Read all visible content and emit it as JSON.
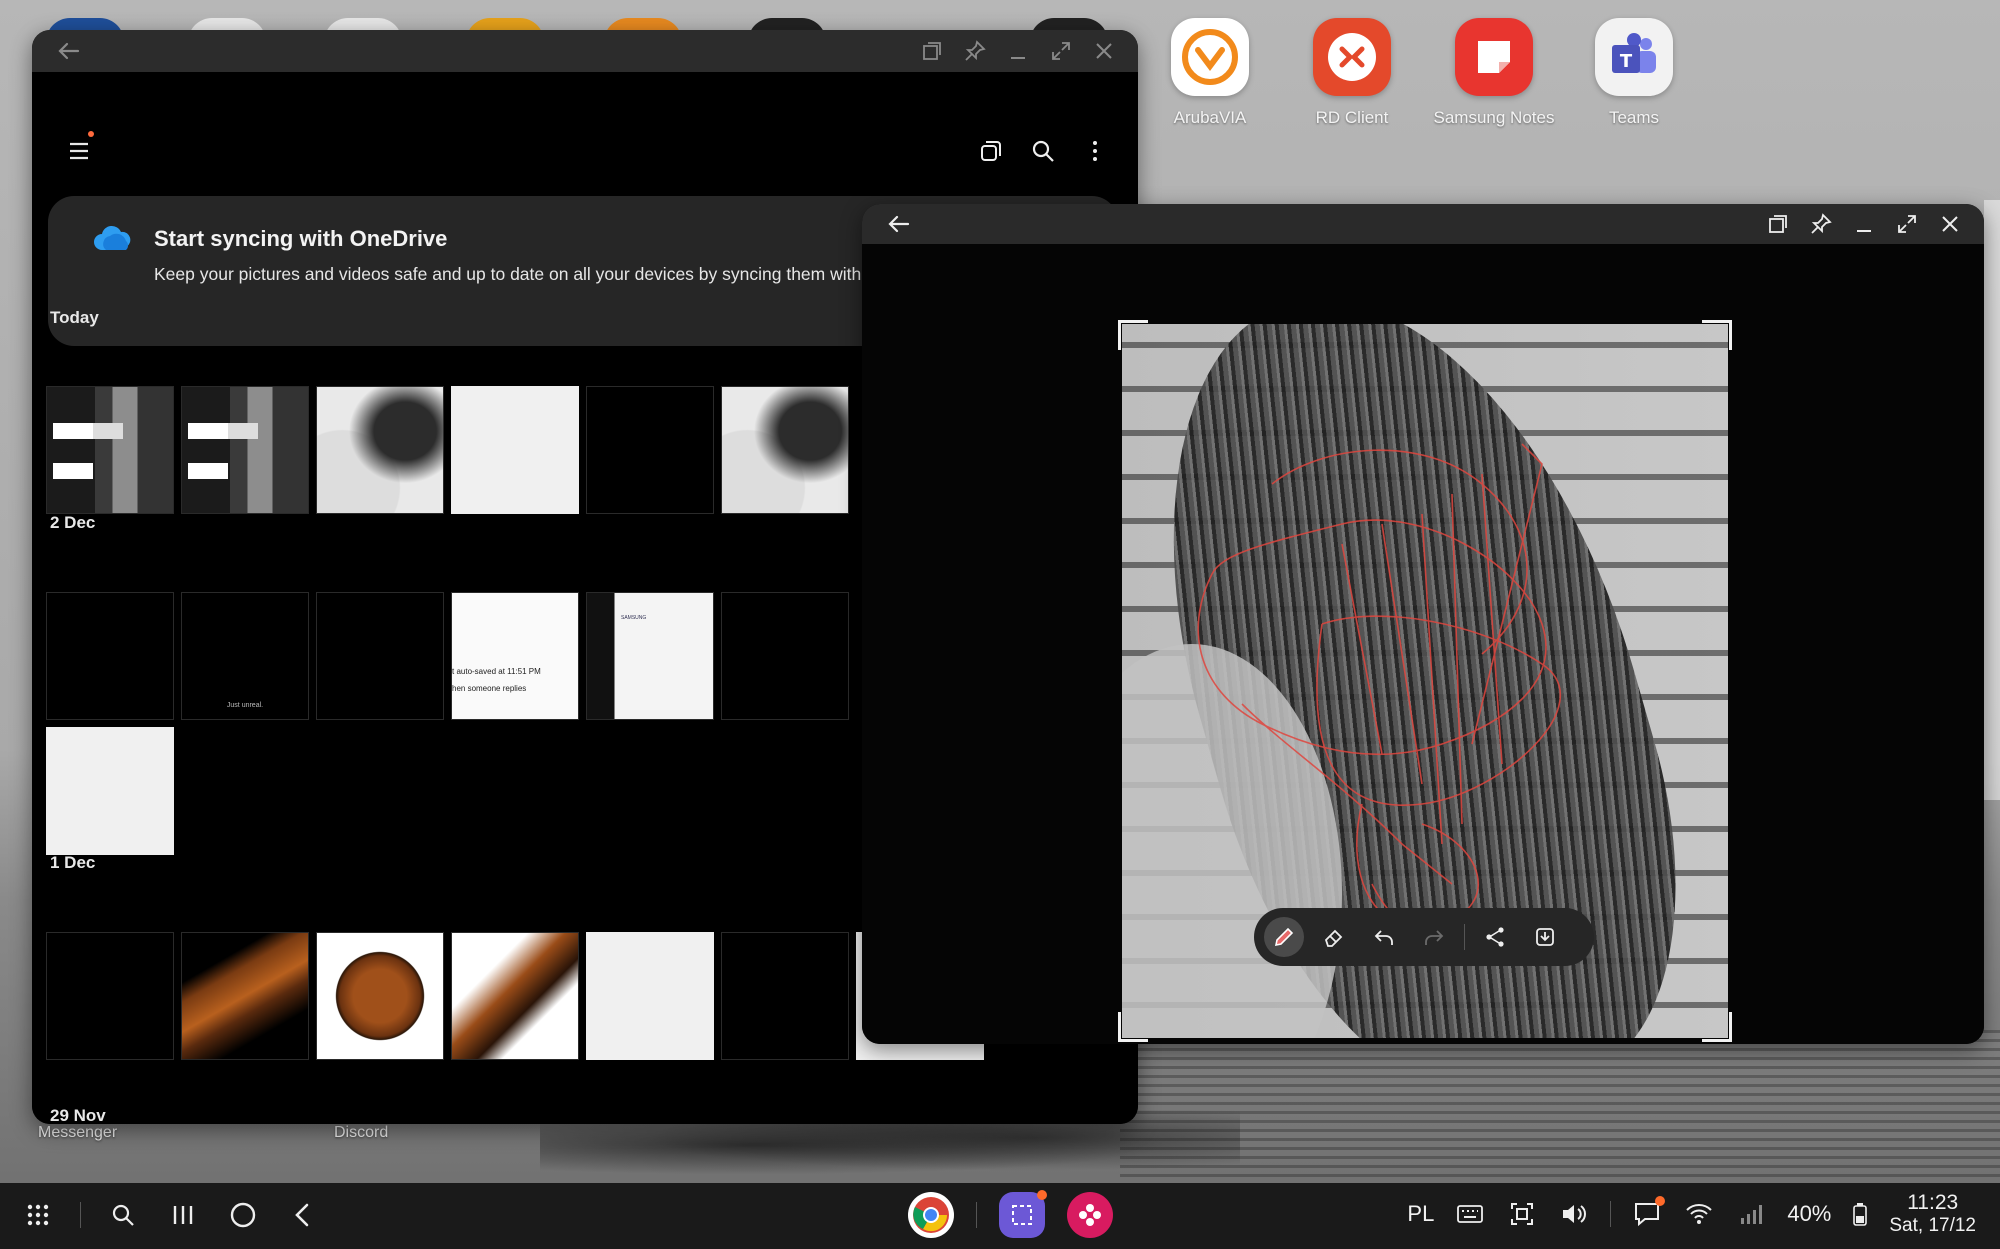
{
  "desktop": {
    "apps": [
      {
        "label": "ArubaVIA",
        "color": "#ffffff",
        "icon": "arubavia-icon"
      },
      {
        "label": "RD Client",
        "color": "#e4492b",
        "icon": "rd-client-icon"
      },
      {
        "label": "Samsung Notes",
        "color": "#e8352f",
        "icon": "samsung-notes-icon"
      },
      {
        "label": "Teams",
        "color": "#ffffff",
        "icon": "teams-icon"
      }
    ],
    "behind_labels": [
      "Messenger",
      "Discord"
    ]
  },
  "gallery": {
    "sync_card": {
      "title": "Start syncing with OneDrive",
      "text": "Keep your pictures and videos safe and up to date on all your devices by syncing them with Mi"
    },
    "sections": [
      {
        "label": "Today"
      },
      {
        "label": "2 Dec"
      },
      {
        "label": "1 Dec"
      },
      {
        "label": "29 Nov"
      }
    ],
    "thumb_texts": {
      "just_unreal": "Just unreal.",
      "doc_line1": "t auto-saved at 11:51 PM",
      "doc_line2": "hen someone replies",
      "ui_brand": "SAMSUNG"
    }
  },
  "taskbar": {
    "language": "PL",
    "battery": "40%",
    "time": "11:23",
    "date": "Sat, 17/12"
  }
}
